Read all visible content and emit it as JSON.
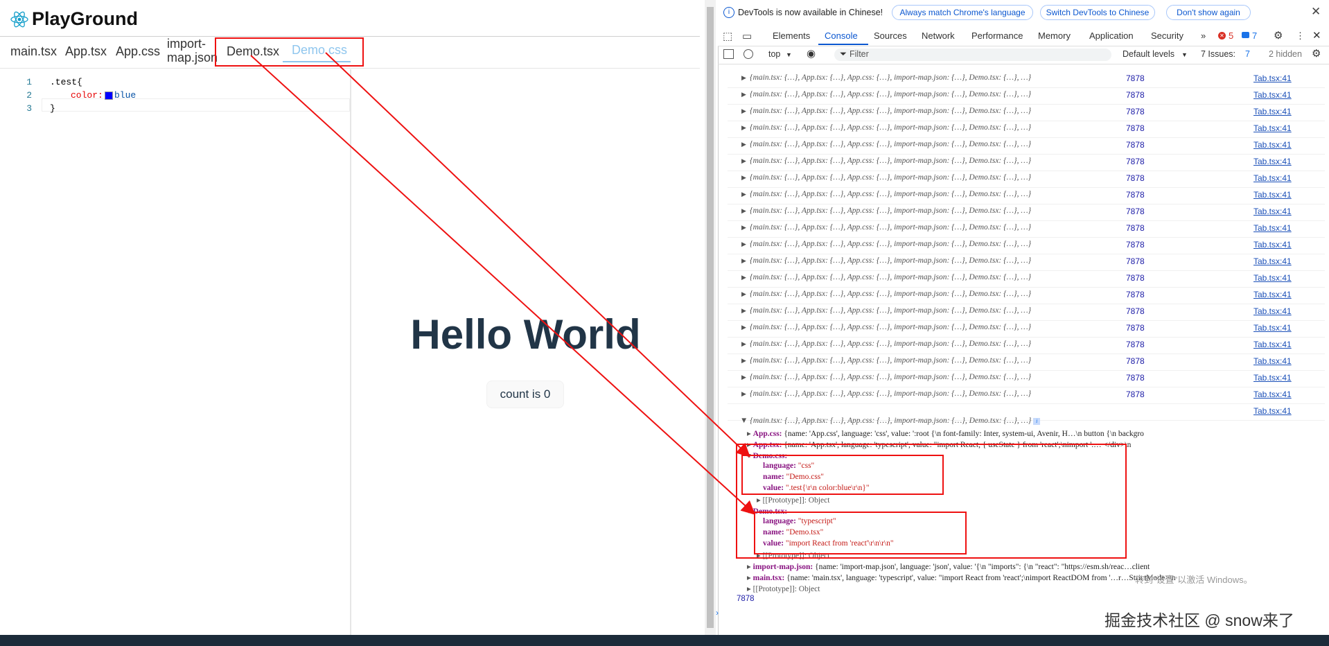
{
  "left": {
    "app_title": "PlayGround",
    "file_tabs": [
      "main.tsx",
      "App.tsx",
      "App.css",
      "import-map.json",
      "Demo.tsx",
      "Demo.css"
    ],
    "active_tab": "Demo.css",
    "code_lines": [
      {
        "num": "1",
        "text": ".test{"
      },
      {
        "num": "2",
        "text": "color:",
        "value": "blue"
      },
      {
        "num": "3",
        "text": "}"
      }
    ],
    "preview_heading": "Hello World",
    "count_button": "count is 0",
    "colors": {
      "accent": "#8fc6ee",
      "heading": "#213547",
      "swatch": "#0000ff"
    }
  },
  "devtools": {
    "infobar_text": "DevTools is now available in Chinese!",
    "infobar_buttons": [
      "Always match Chrome's language",
      "Switch DevTools to Chinese",
      "Don't show again"
    ],
    "tabs": [
      "Elements",
      "Console",
      "Sources",
      "Network",
      "Performance",
      "Memory",
      "Application",
      "Security"
    ],
    "active_tab": "Console",
    "error_count": "5",
    "message_count": "7",
    "context": "top",
    "filter_placeholder": "Filter",
    "levels": "Default levels",
    "issues": "7 Issues:",
    "issues_count": "7",
    "hidden": "2 hidden",
    "log_row_text": "{main.tsx: {…}, App.tsx: {…}, App.css: {…}, import-map.json: {…}, Demo.tsx: {…}, …}",
    "log_value": "7878",
    "log_source": "Tab.tsx:41",
    "log_rows": 20,
    "expanded": {
      "header": "{main.tsx: {…}, App.tsx: {…}, App.css: {…}, import-map.json: {…}, Demo.tsx: {…}, …}",
      "app_css": {
        "key": "App.css:",
        "val": "{name: 'App.css', language: 'css', value: ':root {\\n  font-family: Inter, system-ui, Avenir, H…\\n  button {\\n    backgro"
      },
      "app_tsx": {
        "key": "App.tsx:",
        "val": "{name: 'App.tsx', language: 'typescript', value: \"import React, { useState } from 'react';\\nimport '.…      </div>\\n"
      },
      "demo_css": {
        "key": "Demo.css:",
        "language": "\"css\"",
        "name": "\"Demo.css\"",
        "value": "\".test{\\r\\n    color:blue\\r\\n}\""
      },
      "demo_tsx": {
        "key": "Demo.tsx:",
        "language": "\"typescript\"",
        "name": "\"Demo.tsx\"",
        "value": "\"import React from 'react'\\r\\n\\r\\n\""
      },
      "prototype": "[[Prototype]]: Object",
      "import_map": {
        "key": "import-map.json:",
        "val": "{name: 'import-map.json', language: 'json', value: '{\\n  \"imports\": {\\n    \"react\": \"https://esm.sh/reac…client"
      },
      "main_tsx": {
        "key": "main.tsx:",
        "val": "{name: 'main.tsx', language: 'typescript', value: \"import React from 'react';\\nimport ReactDOM from '…r…StrictMode>\\n"
      },
      "labels": {
        "language": "language:",
        "name": "name:",
        "value": "value:"
      },
      "last_value": "7878"
    }
  },
  "watermark": {
    "activate": "转到\"设置\"以激活 Windows。",
    "source": "掘金技术社区 @ snow来了"
  },
  "colors": {
    "annotation": "#e11111",
    "devtools_blue": "#0b57d0"
  }
}
